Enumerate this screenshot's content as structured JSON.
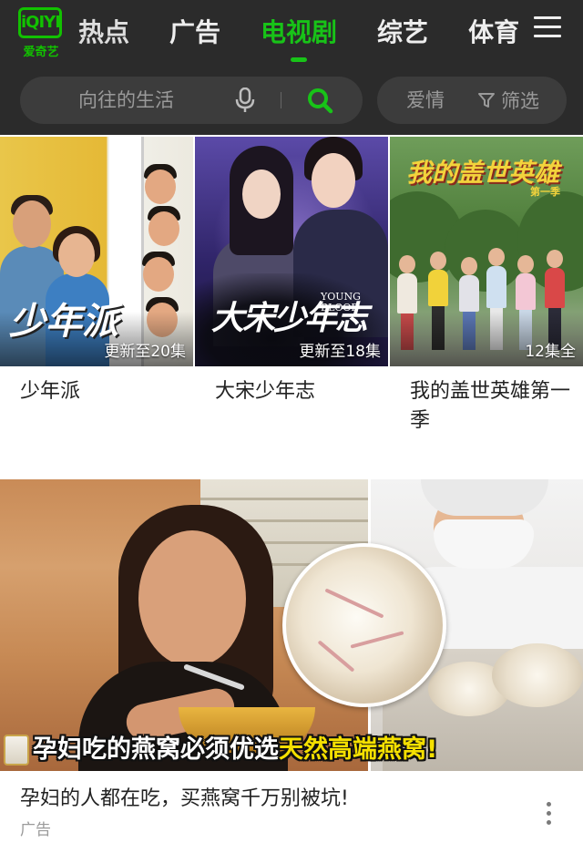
{
  "header": {
    "logo_text": "iQIYI",
    "logo_subtitle": "爱奇艺",
    "tabs": [
      {
        "label": "热点",
        "active": false
      },
      {
        "label": "广告",
        "active": false
      },
      {
        "label": "电视剧",
        "active": true
      },
      {
        "label": "综艺",
        "active": false
      },
      {
        "label": "体育",
        "active": false
      }
    ],
    "menu_icon": "hamburger-menu-icon"
  },
  "search": {
    "placeholder": "向往的生活",
    "mic_icon": "microphone-icon",
    "search_icon": "search-icon"
  },
  "filter": {
    "tag": "爱情",
    "button_label": "筛选",
    "icon": "funnel-filter-icon"
  },
  "shows": [
    {
      "title": "少年派",
      "badge": "更新至20集",
      "poster_logo": "少年派"
    },
    {
      "title": "大宋少年志",
      "badge": "更新至18集",
      "poster_logo": "大宋少年志",
      "poster_logo_en": "YOUNG BLOOD"
    },
    {
      "title": "我的盖世英雄第一季",
      "badge": "12集全",
      "poster_logo": "我的盖世英雄",
      "poster_season": "第一季"
    }
  ],
  "ad": {
    "caption_main": "孕妇吃的燕窝必须优选",
    "caption_highlight": "天然高端燕窝!",
    "title": "孕妇的人都在吃，买燕窝千万别被坑!",
    "label": "广告",
    "more_icon": "more-vertical-icon"
  },
  "colors": {
    "header_bg": "#2b2b2b",
    "accent_green": "#18c318",
    "search_bg": "#3c3c3c",
    "caption_yellow": "#f5e000"
  }
}
